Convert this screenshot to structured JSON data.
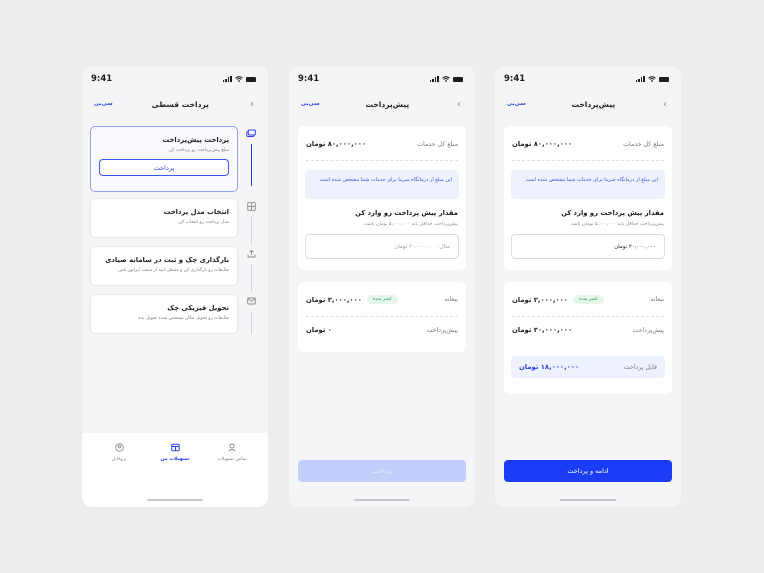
{
  "status": {
    "time": "9:41"
  },
  "brand": "سی‌بی",
  "screen1": {
    "title": "پرداخت قسطی",
    "steps": [
      {
        "title": "پرداخت پیش‌پرداخت",
        "desc": "مبلغ پیش‌پرداخت رو پرداخت کن.",
        "button": "پرداخت"
      },
      {
        "title": "انتخاب مدل پرداخت",
        "desc": "مدل پرداخت رو انتخاب کن."
      },
      {
        "title": "بارگذاری چک و ثبت در سامانه صیادی",
        "desc": "چک‌هات رو بارگذاری کن و منتظر تایید از سمت اپراتور باش."
      },
      {
        "title": "تحویل فیزیکی چک",
        "desc": "چک‌هات رو تحویل مکان مشخص شده تحویل بده."
      }
    ],
    "step_icons": [
      "card-icon",
      "grid-icon",
      "upload-icon",
      "mail-icon"
    ],
    "tabs": [
      {
        "label": "تماس تسهیلات",
        "icon": "contact-icon"
      },
      {
        "label": "تسهیلات من",
        "icon": "wallet-icon",
        "active": true
      },
      {
        "label": "پروفایل",
        "icon": "profile-icon"
      }
    ]
  },
  "screen2": {
    "title": "پیش‌پرداخت",
    "total_label": "مبلغ کل خدمات",
    "total_value": "۸۰,۰۰۰,۰۰۰ تومان",
    "notice": "این مبلغ از درمانگاه سرینا برای خدمات شما مشخص شده است",
    "prompt": "مقدار پیش پرداخت رو وارد کن",
    "hint": "پیش‌پرداخت حداقل باید ۵,۰۰۰,۰۰۰ تومان باشد.",
    "input_placeholder": "مثال: ۲۰,۰۰۰,۰۰۰ تومان",
    "deposit_label": "بیعانه",
    "deposit_value": "۲,۰۰۰,۰۰۰ تومان",
    "deducted_badge": "کسر شده",
    "prepay_label": "پیش‌پرداخت",
    "prepay_value": "۰ تومان",
    "cta": "پرداخت"
  },
  "screen3": {
    "title": "پیش‌پرداخت",
    "total_label": "مبلغ کل خدمات",
    "total_value": "۸۰,۰۰۰,۰۰۰ تومان",
    "notice": "این مبلغ از درمانگاه سرینا برای خدمات شما مشخص شده است",
    "prompt": "مقدار پیش پرداخت رو وارد کن",
    "hint": "پیش‌پرداخت حداقل باید ۵,۰۰۰,۰۰۰ تومان باشد.",
    "input_value": "۲۰,۰۰۰,۰۰۰ تومان",
    "deposit_label": "بیعانه",
    "deposit_value": "۲,۰۰۰,۰۰۰ تومان",
    "deducted_badge": "کسر شده",
    "prepay_label": "پیش‌پرداخت",
    "prepay_value": "۲۰,۰۰۰,۰۰۰ تومان",
    "payable_label": "قابل پرداخت",
    "payable_value": "۱۸,۰۰۰,۰۰۰ تومان",
    "cta": "ادامه و پرداخت"
  },
  "colors": {
    "accent": "#1a3cf5",
    "success": "#2f9f5a",
    "background": "#ededed"
  }
}
